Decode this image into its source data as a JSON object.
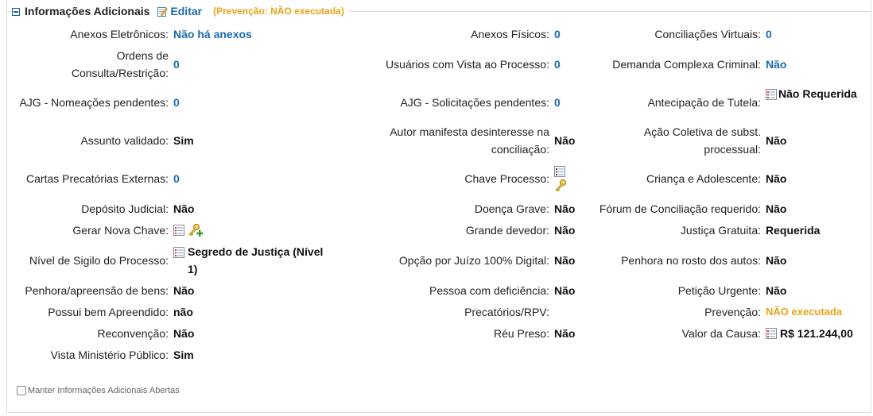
{
  "header": {
    "title": "Informações Adicionais",
    "edit_label": "Editar",
    "prevention_note": "(Prevenção:  NÃO executada)"
  },
  "rows": [
    {
      "c1": {
        "label": "Anexos Eletrônicos:",
        "value": "Não há anexos"
      },
      "c2": {
        "label": "Anexos Físicos:",
        "value": "0"
      },
      "c3": {
        "label": "Conciliações Virtuais:",
        "value": "0"
      }
    },
    {
      "c1": {
        "label": "Ordens de Consulta/Restrição:",
        "value": "0"
      },
      "c2": {
        "label": "Usuários com Vista ao Processo:",
        "value": "0"
      },
      "c3": {
        "label": "Demanda Complexa Criminal:",
        "value": "Não"
      }
    },
    {
      "c1": {
        "label": "AJG - Nomeações pendentes:",
        "value": "0"
      },
      "c2": {
        "label": "AJG - Solicitações pendentes:",
        "value": "0"
      },
      "c3": {
        "label": "Antecipação de Tutela:",
        "value": "Não Requerida"
      }
    },
    {
      "c1": {
        "label": "Assunto validado:",
        "value": "Sim"
      },
      "c2": {
        "label": "Autor manifesta desinteresse na conciliação:",
        "value": "Não"
      },
      "c3": {
        "label": "Ação Coletiva de subst. processual:",
        "value": "Não"
      }
    },
    {
      "c1": {
        "label": "Cartas Precatórias Externas:",
        "value": "0"
      },
      "c2": {
        "label": "Chave Processo:",
        "value": ""
      },
      "c3": {
        "label": "Criança e Adolescente:",
        "value": "Não"
      }
    },
    {
      "c1": {
        "label": "Depósito Judicial:",
        "value": "Não"
      },
      "c2": {
        "label": "Doença Grave:",
        "value": "Não"
      },
      "c3": {
        "label": "Fórum de Conciliação requerido:",
        "value": "Não"
      }
    },
    {
      "c1": {
        "label": "Gerar Nova Chave:",
        "value": ""
      },
      "c2": {
        "label": "Grande devedor:",
        "value": "Não"
      },
      "c3": {
        "label": "Justiça Gratuita:",
        "value": "Requerida"
      }
    },
    {
      "c1": {
        "label": "Nível de Sigilo do Processo:",
        "value": "Segredo de Justiça (Nível 1)"
      },
      "c2": {
        "label": "Opção por Juízo 100% Digital:",
        "value": "Não"
      },
      "c3": {
        "label": "Penhora no rosto dos autos:",
        "value": "Não"
      }
    },
    {
      "c1": {
        "label": "Penhora/apreensão de bens:",
        "value": "Não"
      },
      "c2": {
        "label": "Pessoa com deficiência:",
        "value": "Não"
      },
      "c3": {
        "label": "Petição Urgente:",
        "value": "Não"
      }
    },
    {
      "c1": {
        "label": "Possui bem Apreendido:",
        "value": "não"
      },
      "c2": {
        "label": "Precatórios/RPV:",
        "value": ""
      },
      "c3": {
        "label": "Prevenção:",
        "value": "NÃO executada"
      }
    },
    {
      "c1": {
        "label": "Reconvenção:",
        "value": "Não"
      },
      "c2": {
        "label": "Réu Preso:",
        "value": "Não"
      },
      "c3": {
        "label": "Valor da Causa:",
        "value": "R$ 121.244,00"
      }
    },
    {
      "c1": {
        "label": "Vista Ministério Público:",
        "value": "Sim"
      }
    }
  ],
  "footer": {
    "keep_open_label": "Manter Informações Adicionais Abertas",
    "keep_open_checked": false
  },
  "colors": {
    "link": "#1a6bb0",
    "warning": "#e8a317",
    "border": "#dcdcdc"
  },
  "icons": [
    "collapse-icon",
    "edit-icon",
    "details-icon",
    "key-icon",
    "key-add-icon"
  ]
}
